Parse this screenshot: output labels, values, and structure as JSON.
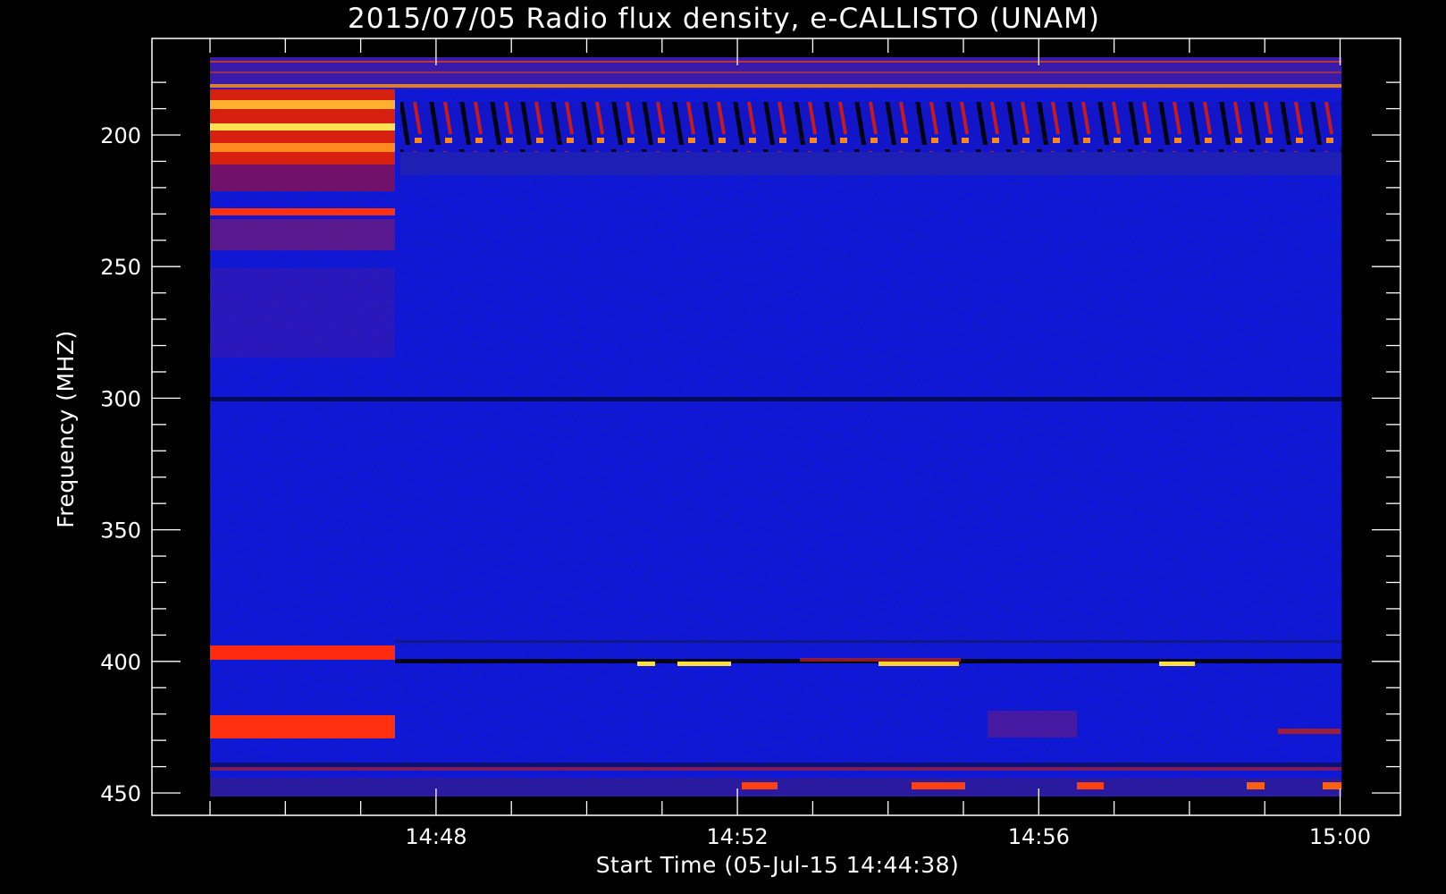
{
  "chart_data": {
    "type": "heatmap",
    "title": "2015/07/05  Radio flux density, e-CALLISTO (UNAM)",
    "xlabel": "Start Time (05-Jul-15 14:44:38)",
    "ylabel": "Frequency (MHZ)",
    "x_ticks": [
      "14:48",
      "14:52",
      "14:56",
      "15:00"
    ],
    "y_ticks": [
      200,
      250,
      300,
      350,
      400,
      450
    ],
    "y_reversed": true,
    "x_range_minutes": [
      0,
      16.6
    ],
    "y_range_mhz": [
      170,
      457
    ],
    "data_x_range_minutes": [
      0.77,
      15.8
    ],
    "data_y_range_mhz": [
      173,
      451
    ],
    "features": [
      {
        "name": "intense band",
        "freq_mhz": [
          183,
          211
        ],
        "time": [
          "14:45",
          "14:47:30"
        ]
      },
      {
        "name": "periodic bursts",
        "freq_mhz": [
          186,
          213
        ],
        "time": [
          "14:47:30",
          "15:00"
        ]
      },
      {
        "name": "interference line",
        "freq_mhz": [
          230,
          230
        ],
        "time": [
          "14:45",
          "14:47:30"
        ]
      },
      {
        "name": "interference line",
        "freq_mhz": [
          397,
          397
        ],
        "time": [
          "14:45",
          "14:47:30"
        ]
      },
      {
        "name": "interference line",
        "freq_mhz": [
          425,
          425
        ],
        "time": [
          "14:45",
          "14:47:30"
        ]
      },
      {
        "name": "dark line",
        "freq_mhz": [
          300,
          300
        ],
        "time": [
          "14:45",
          "15:00"
        ]
      },
      {
        "name": "dark line",
        "freq_mhz": [
          400,
          400
        ],
        "time": [
          "14:47:30",
          "15:00"
        ]
      }
    ],
    "colors": {
      "background": "#000000",
      "low": "#0a14e6",
      "mid": "#e61414",
      "high": "#ffff40"
    }
  }
}
